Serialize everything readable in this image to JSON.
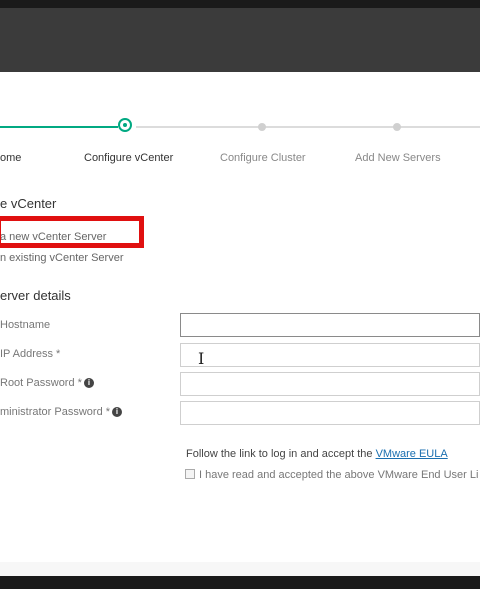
{
  "stepper": {
    "steps": [
      {
        "label": "ome"
      },
      {
        "label": "Configure vCenter"
      },
      {
        "label": "Configure Cluster"
      },
      {
        "label": "Add New Servers"
      }
    ]
  },
  "vcenter_section": {
    "title": "e vCenter",
    "options": [
      "a new vCenter Server",
      "n existing vCenter Server"
    ]
  },
  "server_details": {
    "title": "erver details",
    "fields": [
      {
        "label": "Hostname",
        "value": ""
      },
      {
        "label": "IP Address *",
        "value": ""
      },
      {
        "label": "Root Password *",
        "value": ""
      },
      {
        "label": "ministrator Password *",
        "value": ""
      }
    ]
  },
  "eula": {
    "prefix": "Follow the link to log in and accept the ",
    "link": "VMware EULA",
    "checkbox_label": "I have read and accepted the above VMware End User Li"
  },
  "colors": {
    "accent": "#01a982",
    "highlight": "#e01010",
    "topbar": "#3b3b3b"
  }
}
